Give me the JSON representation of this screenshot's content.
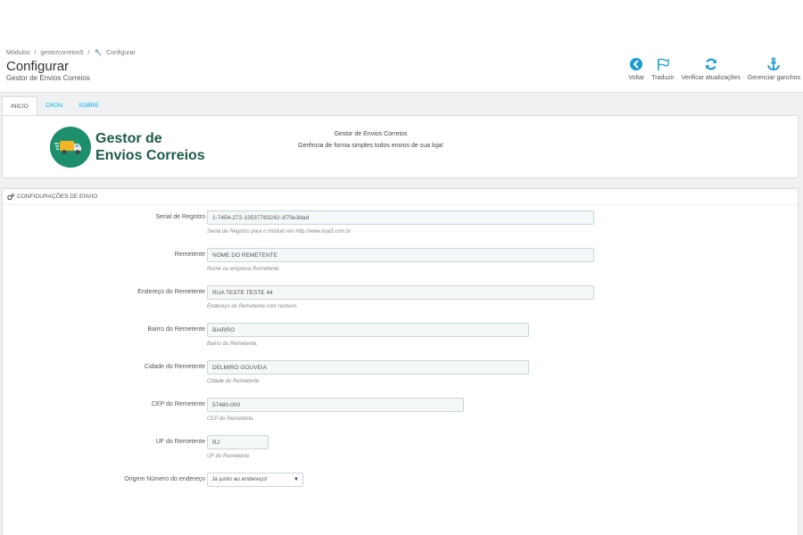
{
  "breadcrumb": [
    "Módulos",
    "/",
    "gestorcorreios5",
    "/",
    "Configurar"
  ],
  "header": {
    "title": "Configurar",
    "subtitle": "Gestor de Envios Correios"
  },
  "toolbar": [
    {
      "label": "Voltar",
      "icon": "back-icon"
    },
    {
      "label": "Traduzir",
      "icon": "flag-icon"
    },
    {
      "label": "Verificar atualizações",
      "icon": "refresh-icon"
    },
    {
      "label": "Gerenciar ganchos",
      "icon": "anchor-icon"
    }
  ],
  "tabs": [
    {
      "label": "INICIO",
      "active": true
    },
    {
      "label": "CRON",
      "active": false
    },
    {
      "label": "SOBRE",
      "active": false
    }
  ],
  "intro": {
    "logo_line1": "Gestor de",
    "logo_line2": "Envios Correios",
    "heading": "Gestor de Envios Correios",
    "text": "Gerência de forma simples todos envios de sua loja!"
  },
  "form": {
    "title": "CONFIGURAÇÕES DE ENVIO",
    "fields": [
      {
        "label": "Serial de Registro",
        "value": "1-7454-272-13537783242-1f70e3dad",
        "help": "Serial de Registro para o módulo em http://www.loja5.com.br"
      },
      {
        "label": "Remetente",
        "value": "NOME DO REMETENTE",
        "help": "Nome ou empresa Remetente."
      },
      {
        "label": "Endereço do Remetente",
        "value": "RUA TESTE TESTE 44",
        "help": "Endereço do Remetente com número."
      },
      {
        "label": "Bairro do Remetente",
        "value": "BAIRRO",
        "help": "Bairro do Remetente."
      },
      {
        "label": "Cidade do Remetente",
        "value": "DELMIRO GOUVEIA",
        "help": "Cidade do Remetente."
      },
      {
        "label": "CEP do Remetente",
        "value": "57480-000",
        "help": "CEP do Remetente."
      },
      {
        "label": "UF do Remetente",
        "value": "RJ",
        "help": "UF do Remetente."
      }
    ],
    "select": {
      "label": "Origem Número do endereço",
      "value": "Já junto ao endereço!"
    }
  },
  "colors": {
    "accent": "#00aff0",
    "icon_blue": "#1a9cd5",
    "logo_green": "#1d8f6d"
  }
}
